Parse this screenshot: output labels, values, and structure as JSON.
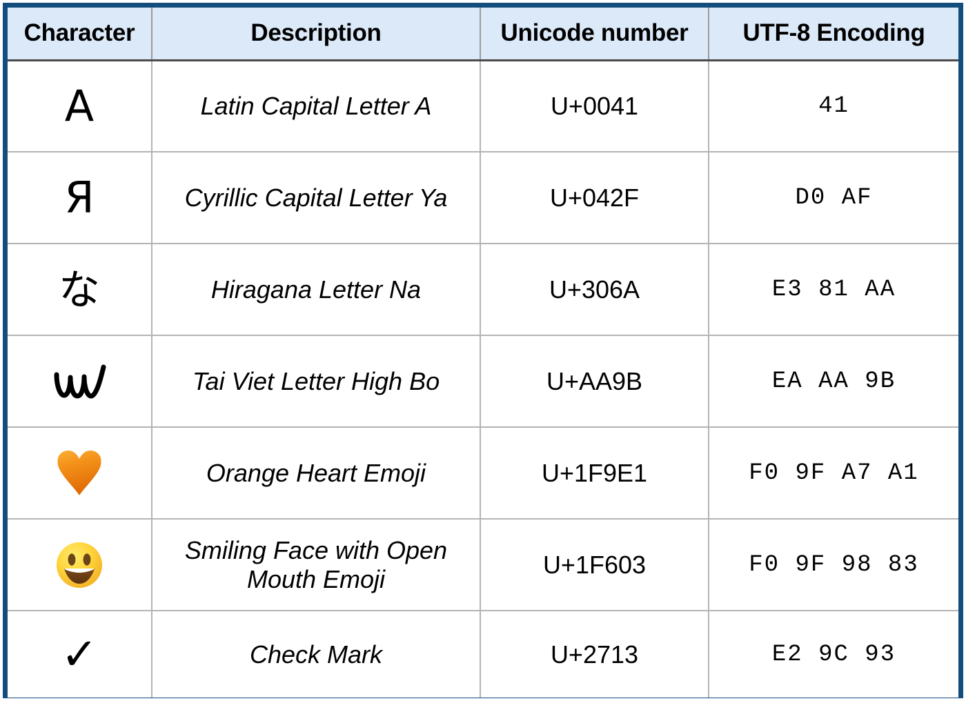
{
  "table": {
    "name": "unicode-utf8-encoding-table",
    "columns": [
      {
        "key": "character",
        "label": "Character"
      },
      {
        "key": "description",
        "label": "Description"
      },
      {
        "key": "unicode",
        "label": "Unicode number"
      },
      {
        "key": "utf8",
        "label": "UTF-8 Encoding"
      }
    ],
    "rows": [
      {
        "character": "A",
        "character_icon": "latin-capital-a-glyph",
        "description": "Latin Capital Letter A",
        "unicode": "U+0041",
        "utf8": "41"
      },
      {
        "character": "Я",
        "character_icon": "cyrillic-ya-glyph",
        "description": "Cyrillic Capital Letter Ya",
        "unicode": "U+042F",
        "utf8": "D0 AF"
      },
      {
        "character": "な",
        "character_icon": "hiragana-na-glyph",
        "description": "Hiragana Letter Na",
        "unicode": "U+306A",
        "utf8": "E3 81 AA"
      },
      {
        "character": "ꪛ",
        "character_icon": "tai-viet-high-bo-glyph",
        "description": "Tai Viet Letter High Bo",
        "unicode": "U+AA9B",
        "utf8": "EA AA 9B"
      },
      {
        "character": "🧡",
        "character_icon": "orange-heart-emoji",
        "description": "Orange Heart Emoji",
        "unicode": "U+1F9E1",
        "utf8": "F0 9F A7 A1"
      },
      {
        "character": "😃",
        "character_icon": "smiling-face-open-mouth-emoji",
        "description": "Smiling Face with Open Mouth Emoji",
        "unicode": "U+1F603",
        "utf8": "F0 9F 98 83"
      },
      {
        "character": "✓",
        "character_icon": "check-mark-glyph",
        "description": "Check Mark",
        "unicode": "U+2713",
        "utf8": "E2 9C 93"
      }
    ]
  },
  "colors": {
    "outer_border": "#124d7d",
    "header_background": "#dce9f9",
    "header_text": "#000000",
    "grid_line": "#b3b3b3",
    "header_rule": "#4a4a4a",
    "orange_heart_light": "#f7a21b",
    "orange_heart_dark": "#e3700a",
    "smiley_face_light": "#ffe14d",
    "smiley_face_dark": "#f0a01e",
    "smiley_feature_dark": "#6b4418",
    "smiley_mouth_white": "#ffffff",
    "body_background": "#ffffff"
  }
}
